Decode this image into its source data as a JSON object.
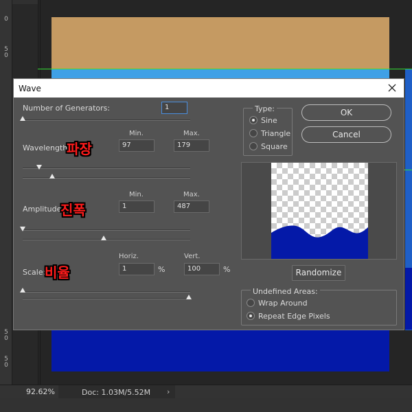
{
  "workspace": {
    "ruler_labels": [
      "0",
      "5\n0",
      "5\n0",
      "5\n0"
    ],
    "status_zoom": "92.62%",
    "status_doc": "Doc: 1.03M/5.52M",
    "status_arrow": "›"
  },
  "dialog": {
    "title": "Wave",
    "generators": {
      "label": "Number of Generators:",
      "value": "1"
    },
    "min_label": "Min.",
    "max_label": "Max.",
    "wavelength": {
      "label": "Wavelength:",
      "korean": "파장",
      "min": "97",
      "max": "179"
    },
    "amplitude": {
      "label": "Amplitude:",
      "korean": "진폭",
      "min": "1",
      "max": "487"
    },
    "scale": {
      "label": "Scale:",
      "korean": "비율",
      "horiz_label": "Horiz.",
      "vert_label": "Vert.",
      "horiz": "1",
      "vert": "100",
      "unit": "%"
    },
    "type": {
      "title": "Type:",
      "options": [
        "Sine",
        "Triangle",
        "Square"
      ],
      "selected": "Sine"
    },
    "buttons": {
      "ok": "OK",
      "cancel": "Cancel",
      "randomize": "Randomize"
    },
    "undefined_areas": {
      "title": "Undefined Areas:",
      "options": [
        "Wrap Around",
        "Repeat Edge Pixels"
      ],
      "selected": "Repeat Edge Pixels"
    }
  },
  "colors": {
    "canvas_top": "#c59a62",
    "canvas_blue": "#0419a8",
    "sky": "#3fa0e6",
    "guide": "#34e034",
    "annotation": "#ff1b1b"
  }
}
